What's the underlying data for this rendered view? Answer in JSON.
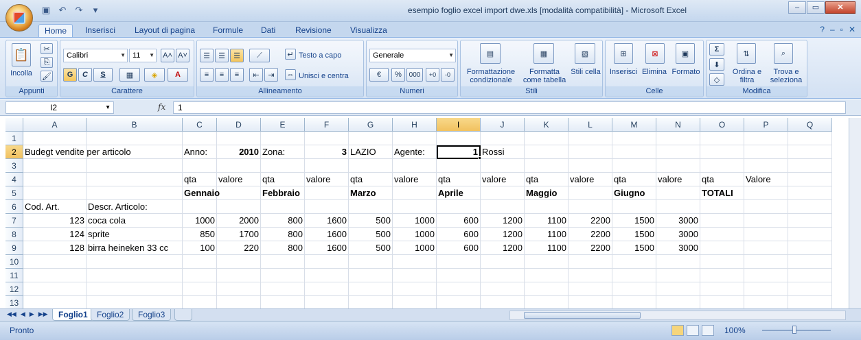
{
  "window": {
    "title": "esempio foglio excel import dwe.xls  [modalità compatibilità] - Microsoft Excel",
    "min": "–",
    "max": "▭",
    "close": "✕"
  },
  "qat": {
    "save_icon": "save-icon",
    "undo": "↶",
    "redo": "↷"
  },
  "tabs": [
    "Home",
    "Inserisci",
    "Layout di pagina",
    "Formule",
    "Dati",
    "Revisione",
    "Visualizza"
  ],
  "ribbon": {
    "clipboard": {
      "label": "Appunti",
      "paste": "Incolla"
    },
    "font": {
      "label": "Carattere",
      "font_name": "Calibri",
      "font_size": "11",
      "bold": "G",
      "italic": "C",
      "underline": "S"
    },
    "alignment": {
      "label": "Allineamento",
      "wrap": "Testo a capo",
      "merge": "Unisci e centra"
    },
    "number": {
      "label": "Numeri",
      "format": "Generale",
      "percent": "%",
      "thousands": "000"
    },
    "styles": {
      "label": "Stili",
      "conditional": "Formattazione condizionale",
      "table": "Formatta come tabella",
      "cell_styles": "Stili cella"
    },
    "cells": {
      "label": "Celle",
      "insert": "Inserisci",
      "delete": "Elimina",
      "format": "Formato"
    },
    "editing": {
      "label": "Modifica",
      "sort": "Ordina e filtra",
      "find": "Trova e seleziona"
    }
  },
  "formula_bar": {
    "name_box": "I2",
    "fx": "fx",
    "value": "1"
  },
  "columns": [
    "A",
    "B",
    "C",
    "D",
    "E",
    "F",
    "G",
    "H",
    "I",
    "J",
    "K",
    "L",
    "M",
    "N",
    "O",
    "P",
    "Q"
  ],
  "rows": [
    "1",
    "2",
    "3",
    "4",
    "5",
    "6",
    "7",
    "8",
    "9",
    "10",
    "11",
    "12",
    "13"
  ],
  "cells": {
    "A2": "Budegt vendite per articolo",
    "C2": "Anno:",
    "D2": "2010",
    "E2": "Zona:",
    "F2": "3",
    "G2": "LAZIO",
    "H2": "Agente:",
    "I2": "1",
    "J2": "Rossi",
    "C4": "qta",
    "D4": "valore",
    "E4": "qta",
    "F4": "valore",
    "G4": "qta",
    "H4": "valore",
    "I4": "qta",
    "J4": "valore",
    "K4": "qta",
    "L4": "valore",
    "M4": "qta",
    "N4": "valore",
    "O4": "qta",
    "P4": "Valore",
    "C5": "Gennaio",
    "E5": "Febbraio",
    "G5": "Marzo",
    "I5": "Aprile",
    "K5": "Maggio",
    "M5": "Giugno",
    "O5": "TOTALI",
    "A6": "Cod. Art.",
    "B6": "Descr. Articolo:",
    "A7": "123",
    "B7": "coca cola",
    "C7": "1000",
    "D7": "2000",
    "E7": "800",
    "F7": "1600",
    "G7": "500",
    "H7": "1000",
    "I7": "600",
    "J7": "1200",
    "K7": "1100",
    "L7": "2200",
    "M7": "1500",
    "N7": "3000",
    "A8": "124",
    "B8": "sprite",
    "C8": "850",
    "D8": "1700",
    "E8": "800",
    "F8": "1600",
    "G8": "500",
    "H8": "1000",
    "I8": "600",
    "J8": "1200",
    "K8": "1100",
    "L8": "2200",
    "M8": "1500",
    "N8": "3000",
    "A9": "128",
    "B9": "birra heineken 33 cc",
    "C9": "100",
    "D9": "220",
    "E9": "800",
    "F9": "1600",
    "G9": "500",
    "H9": "1000",
    "I9": "600",
    "J9": "1200",
    "K9": "1100",
    "L9": "2200",
    "M9": "1500",
    "N9": "3000"
  },
  "sheets": [
    "Foglio1",
    "Foglio2",
    "Foglio3"
  ],
  "status": {
    "ready": "Pronto",
    "zoom": "100%"
  }
}
